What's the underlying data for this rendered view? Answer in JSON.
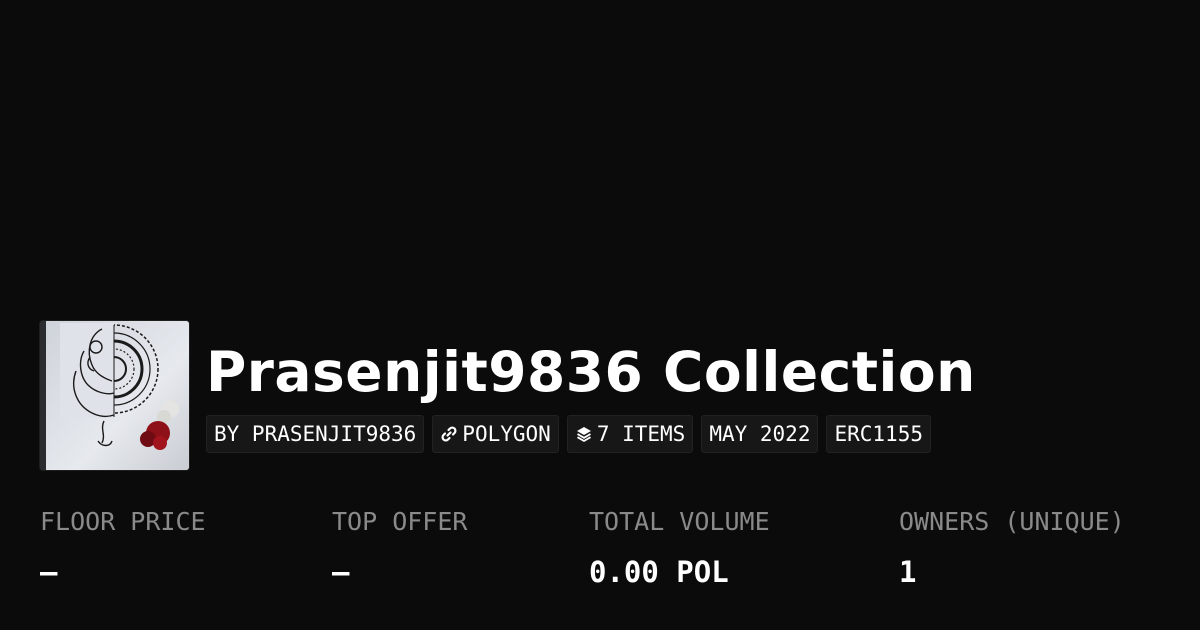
{
  "collection": {
    "title": "Prasenjit9836 Collection"
  },
  "badges": [
    {
      "label": "BY PRASENJIT9836",
      "icon": ""
    },
    {
      "label": "POLYGON",
      "icon": "link-icon"
    },
    {
      "label": "7 ITEMS",
      "icon": "layers-icon"
    },
    {
      "label": "MAY 2022",
      "icon": ""
    },
    {
      "label": "ERC1155",
      "icon": ""
    }
  ],
  "stats": [
    {
      "label": "FLOOR PRICE",
      "value": "–"
    },
    {
      "label": "TOP OFFER",
      "value": "–"
    },
    {
      "label": "TOTAL VOLUME",
      "value": "0.00 POL"
    },
    {
      "label": "OWNERS (UNIQUE)",
      "value": "1"
    }
  ],
  "colors": {
    "background": "#0b0b0b",
    "text": "#ffffff",
    "muted_label": "#8a8a8a",
    "badge_bg": "#171717"
  }
}
